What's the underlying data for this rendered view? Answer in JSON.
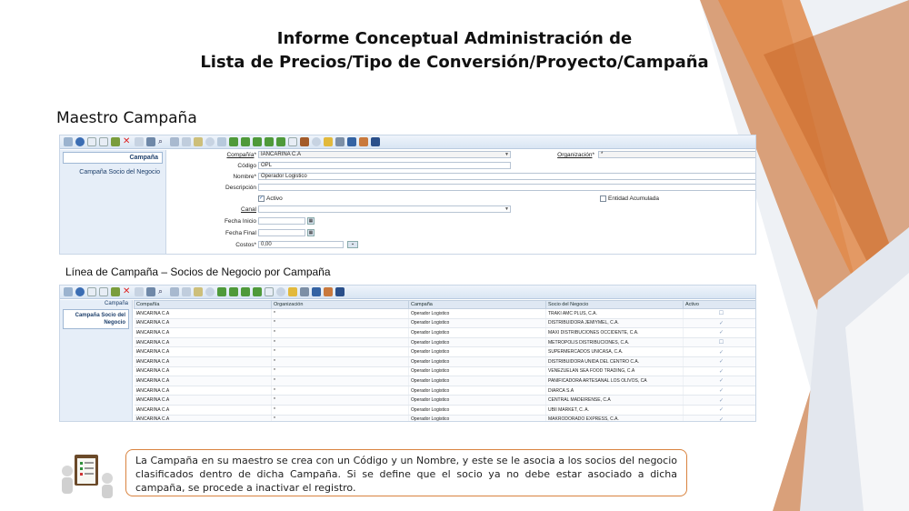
{
  "slide": {
    "title_line1": "Informe Conceptual Administración de",
    "title_line2": "Lista de Precios/Tipo de Conversión/Proyecto/Campaña",
    "section1_title": "Maestro Campaña",
    "section2_title": "Línea de Campaña – Socios de Negocio por Campaña",
    "note": "La Campaña en su maestro se crea con un Código y un Nombre, y este se le asocia a los socios del negocio clasificados dentro de dicha Campaña. Si se define que el socio ya no debe estar asociado a dicha campaña, se procede a inactivar el registro."
  },
  "colors": {
    "accent_orange": "#d9833f",
    "window_blue": "#dfe8f3"
  },
  "form": {
    "sidebar_header": "Campaña",
    "sidebar_item": "Campaña Socio del Negocio",
    "labels": {
      "compania": "Compañía",
      "organizacion": "Organización",
      "codigo": "Código",
      "nombre": "Nombre",
      "descripcion": "Descripción",
      "activo": "Activo",
      "entidad_acumulada": "Entidad Acumulada",
      "canal": "Canal",
      "fecha_inicio": "Fecha Inicio",
      "fecha_final": "Fecha Final",
      "costos": "Costos"
    },
    "values": {
      "compania": "IANCARINA C.A",
      "organizacion": "*",
      "codigo": "OPL",
      "nombre": "Operador Logistico",
      "descripcion": "",
      "canal": "",
      "fecha_inicio": "",
      "fecha_final": "",
      "costos": "0,00"
    }
  },
  "grid": {
    "sidebar_top": "Campaña",
    "sidebar_selected": "Campaña Socio del Negocio",
    "columns": [
      "Compañía",
      "Organización",
      "Campaña",
      "Socio del Negocio",
      "Activo"
    ],
    "rows": [
      {
        "compania": "IANCARINA C.A",
        "org": "*",
        "campana": "Operador Logistico",
        "socio": "TRAKI AMC PLUS, C.A.",
        "activo": "☐"
      },
      {
        "compania": "IANCARINA C.A",
        "org": "*",
        "campana": "Operador Logistico",
        "socio": "DISTRIBUIDORA JEMIYMEL, C.A.",
        "activo": "✓"
      },
      {
        "compania": "IANCARINA C.A",
        "org": "*",
        "campana": "Operador Logistico",
        "socio": "MAXI DISTRIBUCIONES OCCIDENTE, C.A.",
        "activo": "✓"
      },
      {
        "compania": "IANCARINA C.A",
        "org": "*",
        "campana": "Operador Logistico",
        "socio": "METROPOLIS DISTRIBUCIONES, C.A.",
        "activo": "☐"
      },
      {
        "compania": "IANCARINA C.A",
        "org": "*",
        "campana": "Operador Logistico",
        "socio": "SUPERMERCADOS UNICASA, C.A.",
        "activo": "✓"
      },
      {
        "compania": "IANCARINA C.A",
        "org": "*",
        "campana": "Operador Logistico",
        "socio": "DISTRIBUIDORA UNIDA DEL CENTRO C.A.",
        "activo": "✓"
      },
      {
        "compania": "IANCARINA C.A",
        "org": "*",
        "campana": "Operador Logistico",
        "socio": "VENEZUELAN SEA FOOD TRADING, C.A",
        "activo": "✓"
      },
      {
        "compania": "IANCARINA C.A",
        "org": "*",
        "campana": "Operador Logistico",
        "socio": "PANIFICADORA ARTESANAL LOS OLIVOS, CA",
        "activo": "✓"
      },
      {
        "compania": "IANCARINA C.A",
        "org": "*",
        "campana": "Operador Logistico",
        "socio": "DIARCA S.A",
        "activo": "✓"
      },
      {
        "compania": "IANCARINA C.A",
        "org": "*",
        "campana": "Operador Logistico",
        "socio": "CENTRAL MADEIRENSE, C.A",
        "activo": "✓"
      },
      {
        "compania": "IANCARINA C.A",
        "org": "*",
        "campana": "Operador Logistico",
        "socio": "UBII MARKET, C. A.",
        "activo": "✓"
      },
      {
        "compania": "IANCARINA C.A",
        "org": "*",
        "campana": "Operador Logistico",
        "socio": "MAKRODORADO EXPRESS, C.A.",
        "activo": "✓"
      }
    ]
  }
}
